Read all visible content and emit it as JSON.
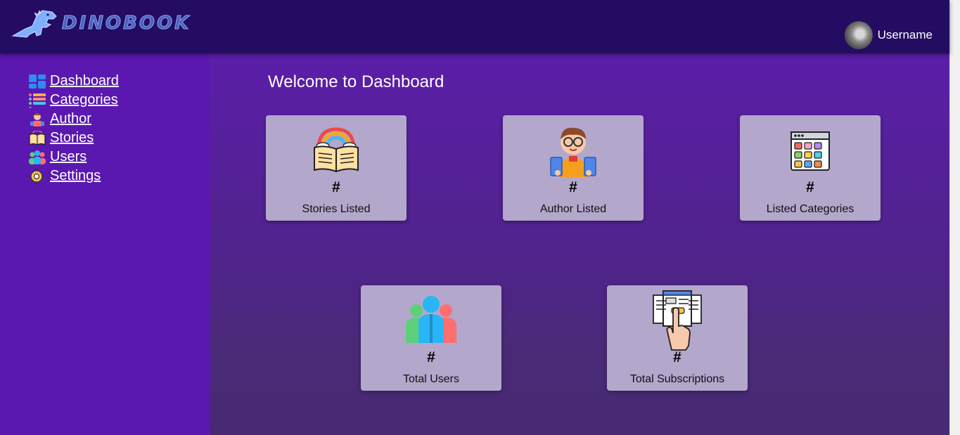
{
  "app": {
    "logo_text": "Dinobook",
    "username": "Username"
  },
  "sidebar": {
    "items": [
      {
        "label": "Dashboard",
        "icon": "dashboard-icon"
      },
      {
        "label": "Categories",
        "icon": "categories-icon"
      },
      {
        "label": "Author",
        "icon": "author-icon"
      },
      {
        "label": "Stories",
        "icon": "stories-icon"
      },
      {
        "label": "Users",
        "icon": "users-icon"
      },
      {
        "label": "Settings",
        "icon": "settings-icon"
      }
    ]
  },
  "main": {
    "title": "Welcome to Dashboard",
    "cards": [
      {
        "count": "#",
        "label": "Stories Listed",
        "icon": "open-book-icon"
      },
      {
        "count": "#",
        "label": "Author Listed",
        "icon": "reader-kid-icon"
      },
      {
        "count": "#",
        "label": "Listed Categories",
        "icon": "category-grid-icon"
      },
      {
        "count": "#",
        "label": "Total Users",
        "icon": "users-group-icon"
      },
      {
        "count": "#",
        "label": "Total Subscriptions",
        "icon": "subscription-tap-icon"
      }
    ]
  },
  "colors": {
    "topbar": "#230c61",
    "sidebar": "#5a18b0",
    "main": "#4e2487",
    "card": "#b3a7cc"
  }
}
